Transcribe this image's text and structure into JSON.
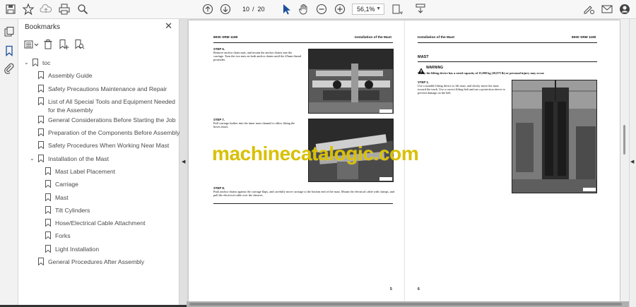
{
  "toolbar": {
    "page_current": "10",
    "page_separator": "/",
    "page_total": "20",
    "zoom": "56,1%",
    "icons": [
      "save-icon",
      "star-icon",
      "cloud-upload-icon",
      "print-icon",
      "search-icon",
      "page-up-icon",
      "page-down-icon",
      "select-cursor-icon",
      "hand-icon",
      "zoom-out-icon",
      "zoom-in-icon",
      "fit-page-icon",
      "scroll-mode-icon",
      "sign-icon",
      "mail-icon",
      "account-icon"
    ]
  },
  "panel": {
    "title": "Bookmarks",
    "root": "toc",
    "items": [
      {
        "label": "Assembly Guide",
        "level": 1
      },
      {
        "label": "Safety Precautions Maintenance and Repair",
        "level": 1
      },
      {
        "label": "List of All Special Tools and Equipment Needed",
        "label2": "for the Assembly",
        "level": 1
      },
      {
        "label": "General Considerations Before Starting the Job",
        "level": 1
      },
      {
        "label": "Preparation of the Components Before Assembly",
        "level": 1
      },
      {
        "label": "Safety Procedures When Working Near Mast",
        "level": 1
      },
      {
        "label": "Installation of the Mast",
        "level": 1,
        "expanded": true
      },
      {
        "label": "Mast Label Placement",
        "level": 2
      },
      {
        "label": "Carriage",
        "level": 2
      },
      {
        "label": "Mast",
        "level": 2
      },
      {
        "label": "Tilt Cylinders",
        "level": 2
      },
      {
        "label": "Hose/Electrical Cable Attachment",
        "level": 2
      },
      {
        "label": "Forks",
        "level": 2
      },
      {
        "label": "Light Installation",
        "level": 2
      },
      {
        "label": "General Procedures After Assembly",
        "level": 1
      }
    ]
  },
  "left_page": {
    "header_left": "8000 SRM 1180",
    "header_right": "Installation of the Mast",
    "step6_title": "STEP 6.",
    "step6_text": "Remove anchor chain nuts, and mount the anchor chains into the carriage. Turn the two nuts on both anchor chains until the 45mm thread protrudes.",
    "step7_title": "STEP 7.",
    "step7_text": "Pull carriage further into the inner mast channel to allow fitting the hoses easier.",
    "step8_title": "STEP 8.",
    "step8_text": "Push anchor chains against the carriage flaps, and carefully move carriage to the bottom end of the mast. Mount the electrical cable with clamps, and pull the electrical cable over the sheaves.",
    "page_number": "5"
  },
  "right_page": {
    "header_left": "Installation of the Mast",
    "header_right": "8000 SRM 1180",
    "section": "MAST",
    "warning_label": "WARNING",
    "warning_text": "Verify the lifting device has a rated capacity of 15,000 kg (30,075 lb) or personal injury may occur.",
    "step1_title": "STEP 1.",
    "step1_text": "Use a suitable lifting device to lift mast, and slowly move the mast toward the truck. Use a correct lifting belt and use a protection sleeve to prevent damage on the belt.",
    "page_number": "6"
  },
  "watermark": "machinecatalogic.com",
  "colors": {
    "watermark": "#d9c000",
    "toolbar_bg": "#f7f7f7",
    "panel_bg": "#ffffff"
  }
}
